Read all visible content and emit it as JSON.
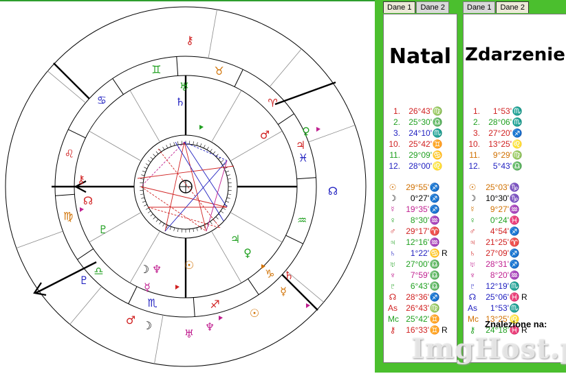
{
  "panel_left": {
    "tabs": [
      "Dane 1",
      "Dane 2"
    ],
    "title": "Natal",
    "houses": [
      {
        "n": "1.",
        "v": "26°43'",
        "s": "♍",
        "c": "#d02020"
      },
      {
        "n": "2.",
        "v": "25°30'",
        "s": "♎",
        "c": "#20a020"
      },
      {
        "n": "3.",
        "v": "24°10'",
        "s": "♏",
        "c": "#2020c0"
      },
      {
        "n": "10.",
        "v": "25°42'",
        "s": "♊",
        "c": "#d02020"
      },
      {
        "n": "11.",
        "v": "29°09'",
        "s": "♋",
        "c": "#20a020"
      },
      {
        "n": "12.",
        "v": "28°00'",
        "s": "♌",
        "c": "#2020c0"
      }
    ],
    "planets": [
      {
        "p": "☉",
        "v": "29°55'",
        "s": "♐",
        "c": "#d07000",
        "r": ""
      },
      {
        "p": "☽",
        "v": "0°27'",
        "s": "♐",
        "c": "#000000",
        "r": ""
      },
      {
        "p": "☿",
        "v": "19°35'",
        "s": "♐",
        "c": "#c02090",
        "r": ""
      },
      {
        "p": "♀",
        "v": "8°30'",
        "s": "♒",
        "c": "#20a020",
        "r": ""
      },
      {
        "p": "♂",
        "v": "29°17'",
        "s": "♈",
        "c": "#d02020",
        "r": ""
      },
      {
        "p": "♃",
        "v": "12°16'",
        "s": "♒",
        "c": "#20a020",
        "r": ""
      },
      {
        "p": "♄",
        "v": "1°22'",
        "s": "♋",
        "c": "#2020c0",
        "r": "R"
      },
      {
        "p": "♅",
        "v": "27°00'",
        "s": "♎",
        "c": "#20a020",
        "r": ""
      },
      {
        "p": "♆",
        "v": "7°59'",
        "s": "♎",
        "c": "#c02090",
        "r": ""
      },
      {
        "p": "♇",
        "v": "6°43'",
        "s": "♎",
        "c": "#20a020",
        "r": ""
      },
      {
        "p": "☊",
        "v": "28°36'",
        "s": "♐",
        "c": "#d02020",
        "r": ""
      },
      {
        "p": "As",
        "v": "26°43'",
        "s": "♍",
        "c": "#d02020",
        "r": ""
      },
      {
        "p": "Mc",
        "v": "25°42'",
        "s": "♊",
        "c": "#20a020",
        "r": ""
      },
      {
        "p": "⚷",
        "v": "16°33'",
        "s": "♊",
        "c": "#d02020",
        "r": "R"
      }
    ]
  },
  "panel_right": {
    "tabs": [
      "Dane 1",
      "Dane 2"
    ],
    "title": "Zdarzenie",
    "houses": [
      {
        "n": "1.",
        "v": "1°53'",
        "s": "♏",
        "c": "#d02020"
      },
      {
        "n": "2.",
        "v": "28°06'",
        "s": "♏",
        "c": "#20a020"
      },
      {
        "n": "3.",
        "v": "27°20'",
        "s": "♐",
        "c": "#d02020"
      },
      {
        "n": "10.",
        "v": "13°25'",
        "s": "♌",
        "c": "#d02020"
      },
      {
        "n": "11.",
        "v": "9°29'",
        "s": "♍",
        "c": "#d07000"
      },
      {
        "n": "12.",
        "v": "5°43'",
        "s": "♎",
        "c": "#2020c0"
      }
    ],
    "planets": [
      {
        "p": "☉",
        "v": "25°03'",
        "s": "♑",
        "c": "#d07000",
        "r": ""
      },
      {
        "p": "☽",
        "v": "10°30'",
        "s": "♑",
        "c": "#000000",
        "r": ""
      },
      {
        "p": "☿",
        "v": "9°27'",
        "s": "♒",
        "c": "#d07000",
        "r": ""
      },
      {
        "p": "♀",
        "v": "0°24'",
        "s": "♓",
        "c": "#20a020",
        "r": ""
      },
      {
        "p": "♂",
        "v": "4°54'",
        "s": "♐",
        "c": "#d02020",
        "r": ""
      },
      {
        "p": "♃",
        "v": "21°25'",
        "s": "♈",
        "c": "#d02020",
        "r": ""
      },
      {
        "p": "♄",
        "v": "27°09'",
        "s": "♐",
        "c": "#d02020",
        "r": ""
      },
      {
        "p": "♅",
        "v": "28°31'",
        "s": "♐",
        "c": "#c02090",
        "r": ""
      },
      {
        "p": "♆",
        "v": "8°20'",
        "s": "♒",
        "c": "#c02090",
        "r": ""
      },
      {
        "p": "♇",
        "v": "12°19'",
        "s": "♏",
        "c": "#2020c0",
        "r": ""
      },
      {
        "p": "☊",
        "v": "25°06'",
        "s": "♓",
        "c": "#2020c0",
        "r": "R"
      },
      {
        "p": "As",
        "v": "1°53'",
        "s": "♏",
        "c": "#2020c0",
        "r": ""
      },
      {
        "p": "Mc",
        "v": "13°25'",
        "s": "♌",
        "c": "#d07000",
        "r": ""
      },
      {
        "p": "⚷",
        "v": "24°18'",
        "s": "♓",
        "c": "#20a020",
        "r": "R"
      }
    ]
  },
  "footer_label": "Znalezione na:",
  "watermark": "ImgHost.pl",
  "wheel": {
    "zodiac_glyphs": [
      {
        "g": "♊",
        "c": "#20a020"
      },
      {
        "g": "♉",
        "c": "#d07000"
      },
      {
        "g": "♈",
        "c": "#d02020"
      },
      {
        "g": "♓",
        "c": "#2020c0"
      },
      {
        "g": "♒",
        "c": "#20a020"
      },
      {
        "g": "♑",
        "c": "#d07000"
      },
      {
        "g": "♐",
        "c": "#d02020"
      },
      {
        "g": "♏",
        "c": "#2020c0"
      },
      {
        "g": "♎",
        "c": "#20a020"
      },
      {
        "g": "♍",
        "c": "#d07000"
      },
      {
        "g": "♌",
        "c": "#d02020"
      },
      {
        "g": "♋",
        "c": "#2020c0"
      }
    ],
    "inner_planets": [
      {
        "g": "♅",
        "c": "#20a020"
      },
      {
        "g": "♄",
        "c": "#2020c0"
      },
      {
        "g": "♂",
        "c": "#d02020"
      },
      {
        "g": "☽",
        "c": "#000000"
      },
      {
        "g": "♆",
        "c": "#c02090"
      },
      {
        "g": "☉",
        "c": "#d07000"
      },
      {
        "g": "♀",
        "c": "#20a020"
      },
      {
        "g": "♃",
        "c": "#20a020"
      },
      {
        "g": "☿",
        "c": "#c02090"
      },
      {
        "g": "♇",
        "c": "#20a020"
      },
      {
        "g": "☊",
        "c": "#d02020"
      },
      {
        "g": "⚷",
        "c": "#d02020"
      }
    ],
    "outer_planets": [
      {
        "g": "⚷",
        "c": "#d02020"
      },
      {
        "g": "☊",
        "c": "#2020c0"
      },
      {
        "g": "♀",
        "c": "#20a020"
      },
      {
        "g": "♃",
        "c": "#d02020"
      },
      {
        "g": "☉",
        "c": "#d07000"
      },
      {
        "g": "♆",
        "c": "#c02090"
      },
      {
        "g": "☽",
        "c": "#000000"
      },
      {
        "g": "♂",
        "c": "#d02020"
      },
      {
        "g": "♇",
        "c": "#2020c0"
      },
      {
        "g": "☿",
        "c": "#d07000"
      },
      {
        "g": "♄",
        "c": "#d02020"
      },
      {
        "g": "♅",
        "c": "#c02090"
      }
    ]
  }
}
